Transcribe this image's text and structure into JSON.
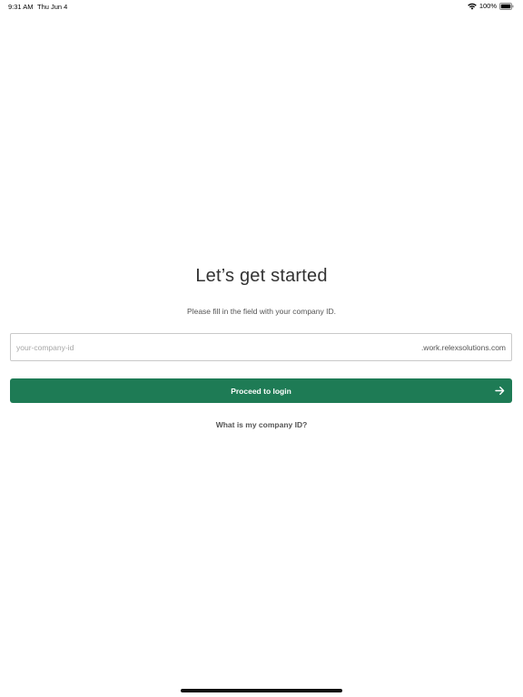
{
  "status_bar": {
    "time": "9:31 AM",
    "date": "Thu Jun 4",
    "battery": "100%",
    "wifi_icon": "wifi-icon",
    "battery_icon": "battery-icon"
  },
  "login": {
    "title": "Let’s get started",
    "subtitle": "Please fill in the field with your company ID.",
    "company_input": {
      "placeholder": "your-company-id",
      "value": "",
      "suffix": ".work.relexsolutions.com"
    },
    "proceed_button": {
      "label": "Proceed to login",
      "icon": "arrow-right-icon",
      "color": "#1e7b55"
    },
    "help_link": "What is my company ID?"
  }
}
